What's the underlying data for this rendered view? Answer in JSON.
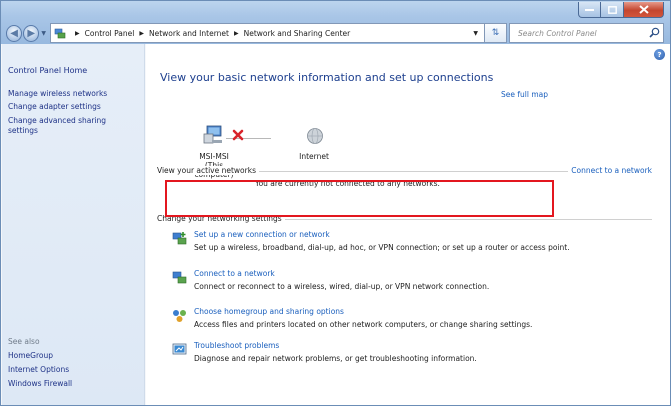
{
  "window": {
    "title": "Network and Sharing Center"
  },
  "address_bar": {
    "breadcrumbs": [
      "Control Panel",
      "Network and Internet",
      "Network and Sharing Center"
    ],
    "search_placeholder": "Search Control Panel"
  },
  "left_pane": {
    "home": "Control Panel Home",
    "links": [
      "Manage wireless networks",
      "Change adapter settings",
      "Change advanced sharing settings"
    ],
    "see_also_label": "See also",
    "see_also": [
      "HomeGroup",
      "Internet Options",
      "Windows Firewall"
    ]
  },
  "main": {
    "heading": "View your basic network information and set up connections",
    "see_full_map": "See full map",
    "computer_name": "MSI-MSI",
    "computer_sub": "(This computer)",
    "internet_label": "Internet",
    "active_networks_label": "View your active networks",
    "connect_link": "Connect to a network",
    "not_connected": "You are currently not connected to any networks.",
    "change_settings_label": "Change your networking settings",
    "tasks": [
      {
        "link": "Set up a new connection or network",
        "desc": "Set up a wireless, broadband, dial-up, ad hoc, or VPN connection; or set up a router or access point.",
        "icon": "network-setup-icon"
      },
      {
        "link": "Connect to a network",
        "desc": "Connect or reconnect to a wireless, wired, dial-up, or VPN network connection.",
        "icon": "connect-network-icon"
      },
      {
        "link": "Choose homegroup and sharing options",
        "desc": "Access files and printers located on other network computers, or change sharing settings.",
        "icon": "homegroup-icon"
      },
      {
        "link": "Troubleshoot problems",
        "desc": "Diagnose and repair network problems, or get troubleshooting information.",
        "icon": "troubleshoot-icon"
      }
    ]
  },
  "colors": {
    "link": "#1a5fbd",
    "heading": "#1d3f8e",
    "highlight": "#e3171f",
    "left_pane_bg": "#e2ebf6"
  }
}
